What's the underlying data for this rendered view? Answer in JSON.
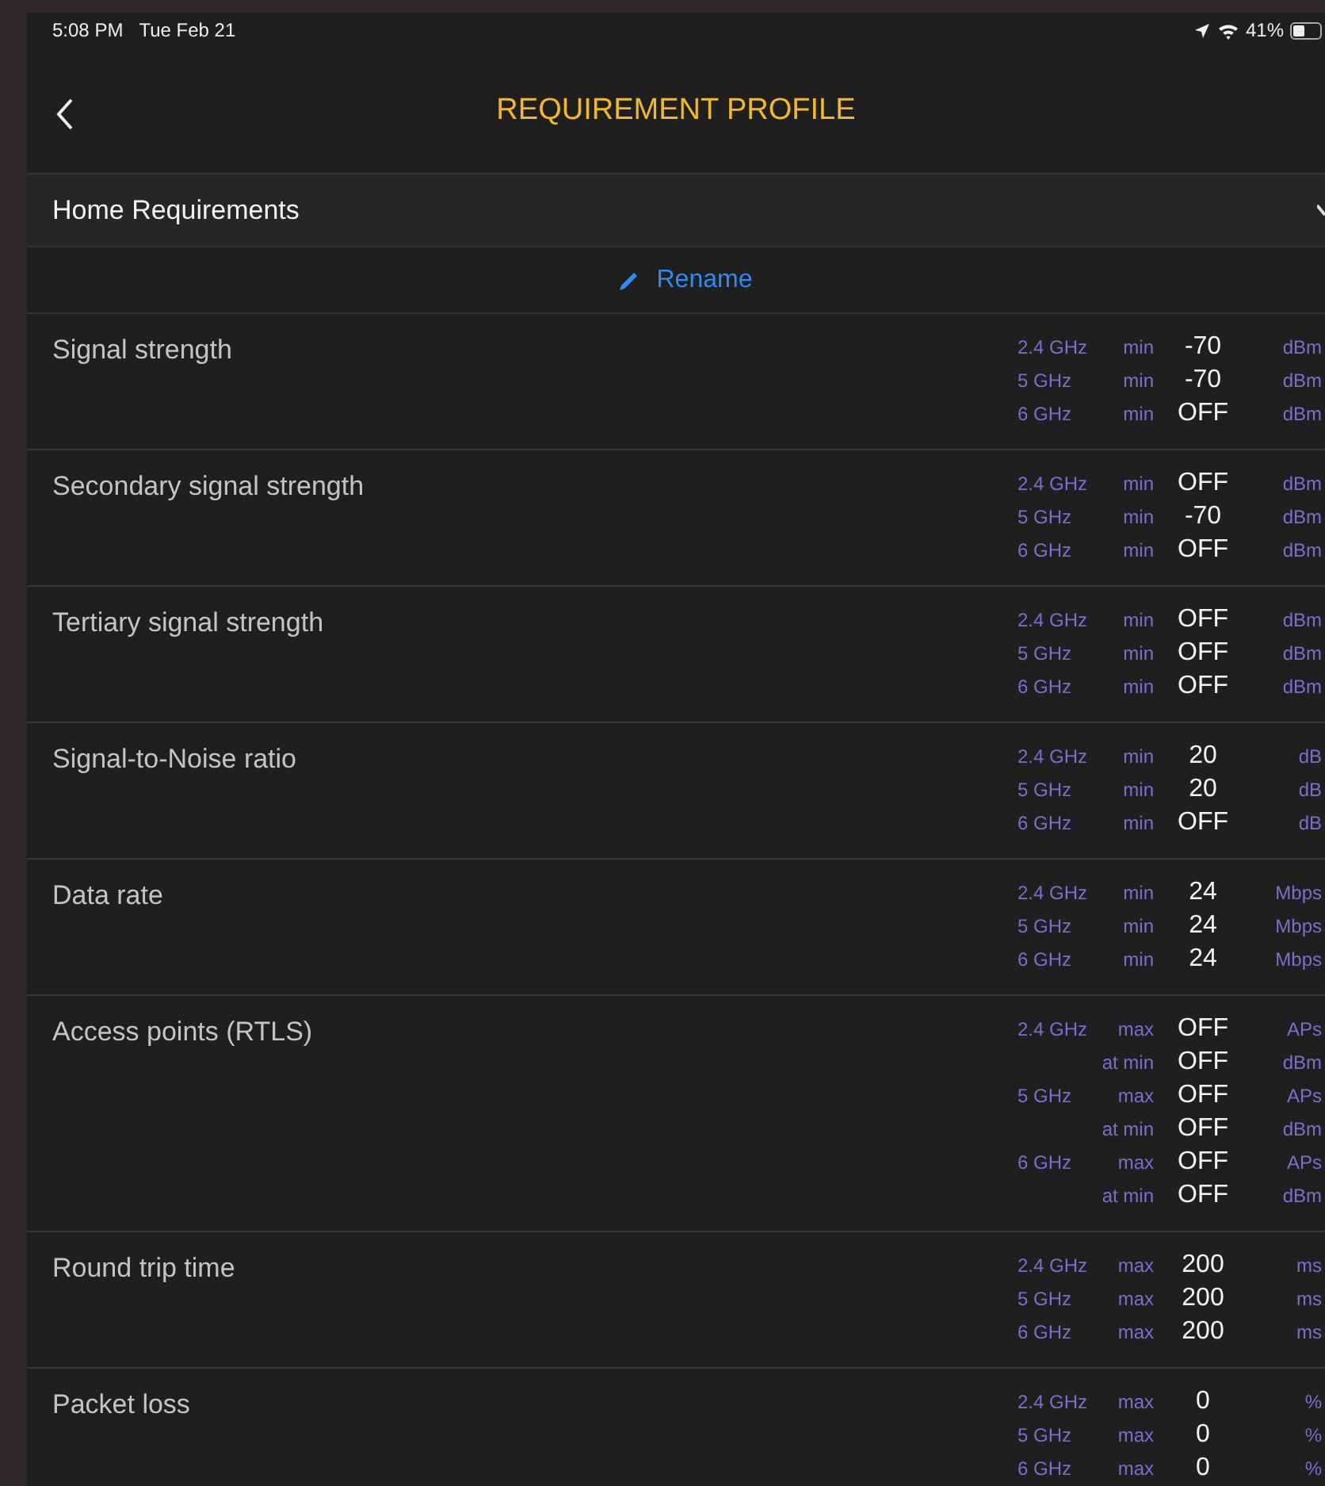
{
  "status_bar": {
    "time": "5:08 PM",
    "date": "Tue Feb 21",
    "battery": "41%"
  },
  "nav": {
    "title": "REQUIREMENT PROFILE"
  },
  "profile": {
    "name": "Home Requirements",
    "rename": "Rename"
  },
  "requirements": [
    {
      "name": "Signal strength",
      "lines": [
        {
          "band": "2.4 GHz",
          "qualifier": "min",
          "value": "-70",
          "unit": "dBm"
        },
        {
          "band": "5 GHz",
          "qualifier": "min",
          "value": "-70",
          "unit": "dBm"
        },
        {
          "band": "6 GHz",
          "qualifier": "min",
          "value": "OFF",
          "unit": "dBm"
        }
      ]
    },
    {
      "name": "Secondary signal strength",
      "lines": [
        {
          "band": "2.4 GHz",
          "qualifier": "min",
          "value": "OFF",
          "unit": "dBm"
        },
        {
          "band": "5 GHz",
          "qualifier": "min",
          "value": "-70",
          "unit": "dBm"
        },
        {
          "band": "6 GHz",
          "qualifier": "min",
          "value": "OFF",
          "unit": "dBm"
        }
      ]
    },
    {
      "name": "Tertiary signal strength",
      "lines": [
        {
          "band": "2.4 GHz",
          "qualifier": "min",
          "value": "OFF",
          "unit": "dBm"
        },
        {
          "band": "5 GHz",
          "qualifier": "min",
          "value": "OFF",
          "unit": "dBm"
        },
        {
          "band": "6 GHz",
          "qualifier": "min",
          "value": "OFF",
          "unit": "dBm"
        }
      ]
    },
    {
      "name": "Signal-to-Noise ratio",
      "lines": [
        {
          "band": "2.4 GHz",
          "qualifier": "min",
          "value": "20",
          "unit": "dB"
        },
        {
          "band": "5 GHz",
          "qualifier": "min",
          "value": "20",
          "unit": "dB"
        },
        {
          "band": "6 GHz",
          "qualifier": "min",
          "value": "OFF",
          "unit": "dB"
        }
      ]
    },
    {
      "name": "Data rate",
      "lines": [
        {
          "band": "2.4 GHz",
          "qualifier": "min",
          "value": "24",
          "unit": "Mbps"
        },
        {
          "band": "5 GHz",
          "qualifier": "min",
          "value": "24",
          "unit": "Mbps"
        },
        {
          "band": "6 GHz",
          "qualifier": "min",
          "value": "24",
          "unit": "Mbps"
        }
      ]
    },
    {
      "name": "Access points (RTLS)",
      "lines": [
        {
          "band": "2.4 GHz",
          "qualifier": "max",
          "value": "OFF",
          "unit": "APs"
        },
        {
          "qualifier": "at min",
          "value": "OFF",
          "unit": "dBm"
        },
        {
          "band": "5 GHz",
          "qualifier": "max",
          "value": "OFF",
          "unit": "APs"
        },
        {
          "qualifier": "at min",
          "value": "OFF",
          "unit": "dBm"
        },
        {
          "band": "6 GHz",
          "qualifier": "max",
          "value": "OFF",
          "unit": "APs"
        },
        {
          "qualifier": "at min",
          "value": "OFF",
          "unit": "dBm"
        }
      ]
    },
    {
      "name": "Round trip time",
      "lines": [
        {
          "band": "2.4 GHz",
          "qualifier": "max",
          "value": "200",
          "unit": "ms"
        },
        {
          "band": "5 GHz",
          "qualifier": "max",
          "value": "200",
          "unit": "ms"
        },
        {
          "band": "6 GHz",
          "qualifier": "max",
          "value": "200",
          "unit": "ms"
        }
      ]
    },
    {
      "name": "Packet loss",
      "lines": [
        {
          "band": "2.4 GHz",
          "qualifier": "max",
          "value": "0",
          "unit": "%"
        },
        {
          "band": "5 GHz",
          "qualifier": "max",
          "value": "0",
          "unit": "%"
        },
        {
          "band": "6 GHz",
          "qualifier": "max",
          "value": "0",
          "unit": "%"
        }
      ]
    }
  ]
}
